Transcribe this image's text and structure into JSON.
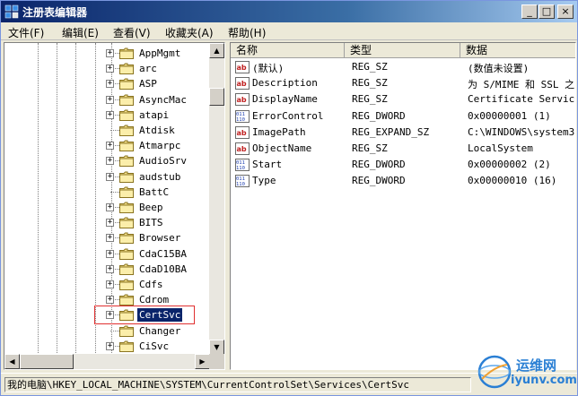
{
  "window": {
    "title": "注册表编辑器",
    "min_label": "_",
    "max_label": "□",
    "close_label": "×"
  },
  "menu": [
    {
      "label": "文件(F)"
    },
    {
      "label": "编辑(E)"
    },
    {
      "label": "查看(V)"
    },
    {
      "label": "收藏夹(A)"
    },
    {
      "label": "帮助(H)"
    }
  ],
  "tree": {
    "items": [
      {
        "label": "AppMgmt",
        "expander": "+"
      },
      {
        "label": "arc",
        "expander": "+"
      },
      {
        "label": "ASP",
        "expander": "+"
      },
      {
        "label": "AsyncMac",
        "expander": "+"
      },
      {
        "label": "atapi",
        "expander": "+"
      },
      {
        "label": "Atdisk",
        "expander": ""
      },
      {
        "label": "Atmarpc",
        "expander": "+"
      },
      {
        "label": "AudioSrv",
        "expander": "+"
      },
      {
        "label": "audstub",
        "expander": "+"
      },
      {
        "label": "BattC",
        "expander": ""
      },
      {
        "label": "Beep",
        "expander": "+"
      },
      {
        "label": "BITS",
        "expander": "+"
      },
      {
        "label": "Browser",
        "expander": "+"
      },
      {
        "label": "CdaC15BA",
        "expander": "+"
      },
      {
        "label": "CdaD10BA",
        "expander": "+"
      },
      {
        "label": "Cdfs",
        "expander": "+"
      },
      {
        "label": "Cdrom",
        "expander": "+"
      },
      {
        "label": "CertSvc",
        "expander": "+",
        "selected": true
      },
      {
        "label": "Changer",
        "expander": ""
      },
      {
        "label": "CiSvc",
        "expander": "+"
      }
    ]
  },
  "list": {
    "columns": {
      "name": "名称",
      "type": "类型",
      "data": "数据"
    },
    "rows": [
      {
        "icon": "string-value-icon",
        "name": "(默认)",
        "type": "REG_SZ",
        "data": "(数值未设置)"
      },
      {
        "icon": "string-value-icon",
        "name": "Description",
        "type": "REG_SZ",
        "data": "为 S/MIME 和 SSL 之"
      },
      {
        "icon": "string-value-icon",
        "name": "DisplayName",
        "type": "REG_SZ",
        "data": "Certificate Servic"
      },
      {
        "icon": "dword-value-icon",
        "name": "ErrorControl",
        "type": "REG_DWORD",
        "data": "0x00000001 (1)"
      },
      {
        "icon": "string-value-icon",
        "name": "ImagePath",
        "type": "REG_EXPAND_SZ",
        "data": "C:\\WINDOWS\\system3"
      },
      {
        "icon": "string-value-icon",
        "name": "ObjectName",
        "type": "REG_SZ",
        "data": "LocalSystem"
      },
      {
        "icon": "dword-value-icon",
        "name": "Start",
        "type": "REG_DWORD",
        "data": "0x00000002 (2)"
      },
      {
        "icon": "dword-value-icon",
        "name": "Type",
        "type": "REG_DWORD",
        "data": "0x00000010 (16)"
      }
    ]
  },
  "status": {
    "path": "我的电脑\\HKEY_LOCAL_MACHINE\\SYSTEM\\CurrentControlSet\\Services\\CertSvc"
  },
  "watermark": {
    "line1": "运维网",
    "line2": "iyunv.com"
  }
}
